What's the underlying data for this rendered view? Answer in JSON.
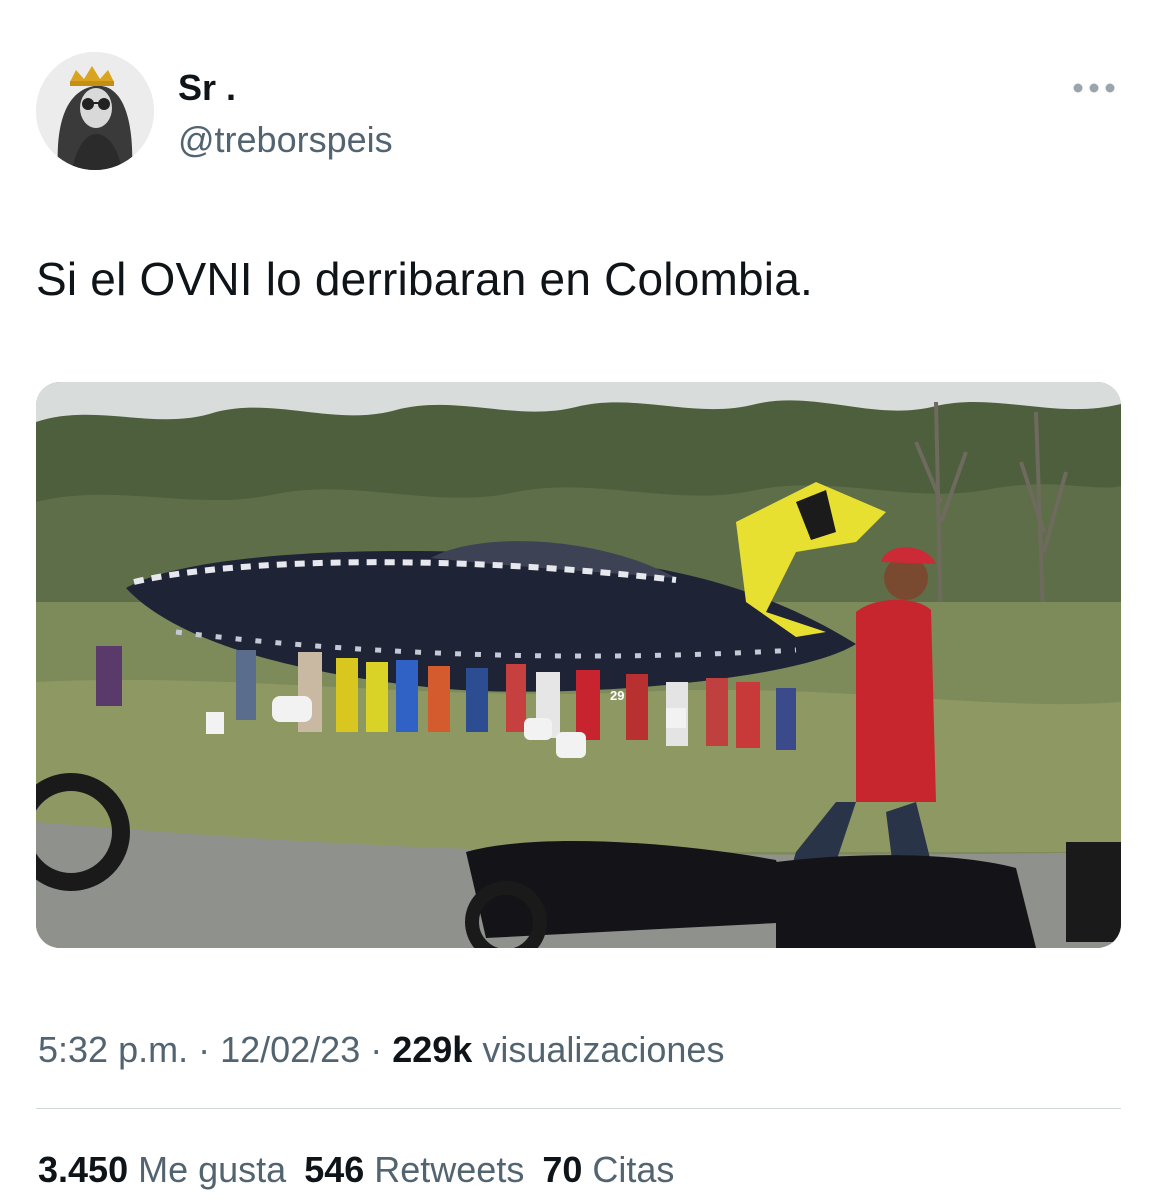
{
  "author": {
    "display_name": "Sr .",
    "handle": "@treborspeis",
    "avatar_icon": "profile-photo-with-crown"
  },
  "menu": {
    "more_icon": "more-horizontal-icon"
  },
  "tweet": {
    "text": "Si el OVNI lo derribaran en Colombia."
  },
  "media": {
    "image_content": "edited photo of a crashed flying saucer on a roadside with a crowd of people carrying plastic containers, motorcycles in the foreground",
    "jersey_number": "29"
  },
  "meta": {
    "time": "5:32 p.m.",
    "separator": " · ",
    "date": "12/02/23",
    "views_count": "229k",
    "views_label": " visualizaciones"
  },
  "stats": {
    "likes_count": "3.450",
    "likes_label": " Me gusta",
    "retweets_count": "546",
    "retweets_label": " Retweets",
    "quotes_count": "70",
    "quotes_label": " Citas"
  },
  "colors": {
    "text_primary": "#0f1419",
    "text_secondary": "#536471",
    "divider": "#cfd9de"
  }
}
